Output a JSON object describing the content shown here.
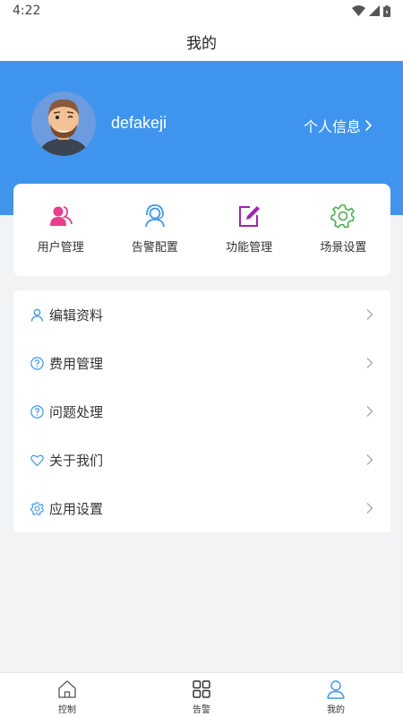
{
  "status_bar": {
    "time": "4:22"
  },
  "header": {
    "title": "我的"
  },
  "profile": {
    "username": "defakeji",
    "link_label": "个人信息"
  },
  "functions": [
    {
      "label": "用户管理",
      "icon": "users-icon",
      "color": "#e83e8c"
    },
    {
      "label": "告警配置",
      "icon": "headset-user-icon",
      "color": "#3f95ee"
    },
    {
      "label": "功能管理",
      "icon": "edit-icon",
      "color": "#9c27b0"
    },
    {
      "label": "场景设置",
      "icon": "gear-icon",
      "color": "#4caf50"
    }
  ],
  "menu": [
    {
      "label": "编辑资料",
      "icon": "user-icon"
    },
    {
      "label": "费用管理",
      "icon": "question-circle-icon"
    },
    {
      "label": "问题处理",
      "icon": "question-circle-icon"
    },
    {
      "label": "关于我们",
      "icon": "heart-icon"
    },
    {
      "label": "应用设置",
      "icon": "gear-icon"
    }
  ],
  "tabbar": [
    {
      "label": "控制",
      "icon": "home-icon",
      "active": false
    },
    {
      "label": "告警",
      "icon": "grid-icon",
      "active": false
    },
    {
      "label": "我的",
      "icon": "user-icon",
      "active": true
    }
  ],
  "colors": {
    "primary": "#3f95ee",
    "background": "#f2f3f5"
  }
}
